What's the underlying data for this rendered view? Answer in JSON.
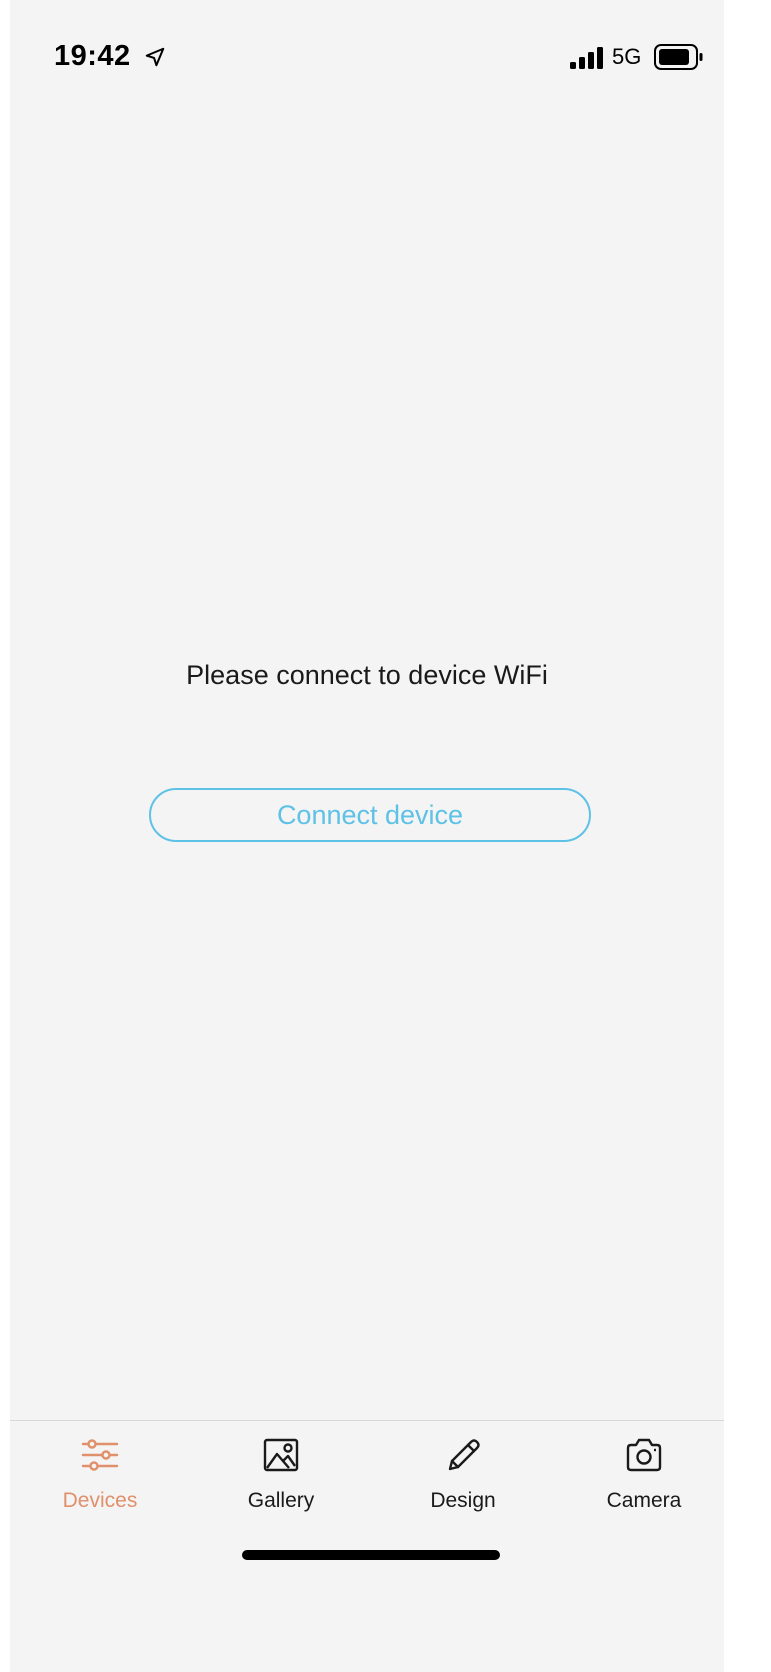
{
  "status_bar": {
    "time": "19:42",
    "network": "5G",
    "icons": [
      "location-arrow-icon",
      "signal-icon",
      "battery-icon"
    ]
  },
  "main": {
    "prompt": "Please connect to device WiFi",
    "connect_button_label": "Connect device"
  },
  "tab_bar": {
    "tabs": [
      {
        "label": "Devices",
        "icon": "sliders-icon",
        "active": true
      },
      {
        "label": "Gallery",
        "icon": "image-icon",
        "active": false
      },
      {
        "label": "Design",
        "icon": "pencil-icon",
        "active": false
      },
      {
        "label": "Camera",
        "icon": "camera-icon",
        "active": false
      }
    ]
  },
  "colors": {
    "accent_active_tab": "#e0906a",
    "button_accent": "#5ec1e6",
    "background": "#f4f4f4"
  }
}
